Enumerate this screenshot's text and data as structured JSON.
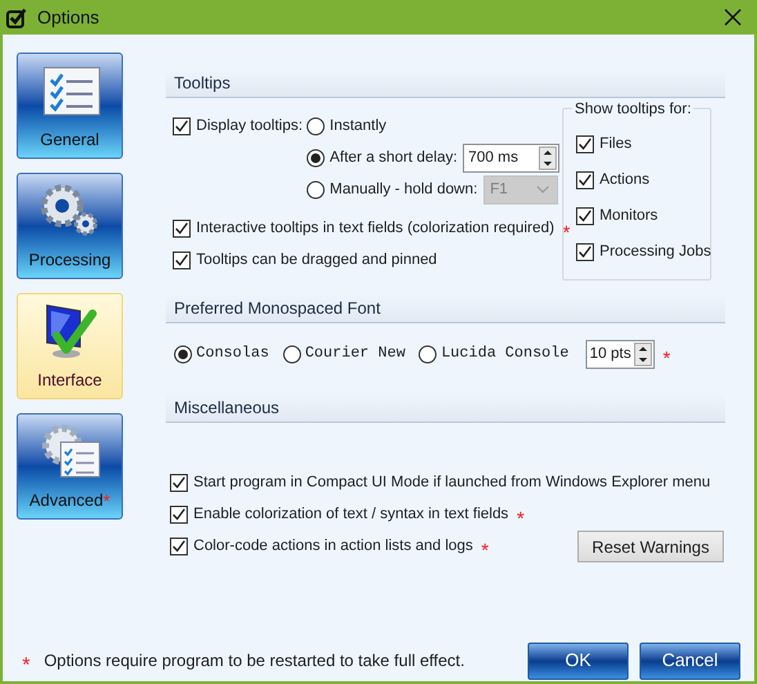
{
  "window": {
    "title": "Options"
  },
  "sidebar": [
    {
      "label": "General",
      "kind": "checklist",
      "selected": false
    },
    {
      "label": "Processing",
      "kind": "gears",
      "selected": false
    },
    {
      "label": "Interface",
      "kind": "monitor",
      "selected": true
    },
    {
      "label": "Advanced",
      "kind": "gearlist",
      "selected": false,
      "mark": "*"
    }
  ],
  "tooltips": {
    "title": "Tooltips",
    "display": {
      "label": "Display tooltips:",
      "checked": true
    },
    "timing": [
      {
        "kind": "plain",
        "label": "Instantly",
        "selected": false
      },
      {
        "kind": "spinner",
        "label": "After a short delay:",
        "selected": true,
        "value": "700 ms"
      },
      {
        "kind": "dropdown",
        "label": "Manually - hold down:",
        "selected": false,
        "value": "F1",
        "disabled": true
      }
    ],
    "options": [
      {
        "label": "Interactive tooltips in text fields (colorization required)",
        "checked": true,
        "mark": "*"
      },
      {
        "label": "Tooltips can be dragged and pinned",
        "checked": true
      }
    ],
    "show_for": {
      "title": "Show tooltips for:",
      "items": [
        {
          "label": "Files",
          "checked": true
        },
        {
          "label": "Actions",
          "checked": true
        },
        {
          "label": "Monitors",
          "checked": true
        },
        {
          "label": "Processing Jobs",
          "checked": true
        }
      ]
    }
  },
  "font": {
    "title": "Preferred Monospaced Font",
    "choices": [
      {
        "label": "Consolas",
        "selected": true
      },
      {
        "label": "Courier New",
        "selected": false
      },
      {
        "label": "Lucida Console",
        "selected": false
      }
    ],
    "size": "10 pts",
    "mark": "*"
  },
  "misc": {
    "title": "Miscellaneous",
    "options": [
      {
        "label": "Start program in Compact UI Mode if launched from Windows Explorer menu",
        "checked": true
      },
      {
        "label": "Enable colorization of text / syntax in text fields",
        "checked": true,
        "mark": "*"
      },
      {
        "label": "Color-code actions in action lists and logs",
        "checked": true,
        "mark": "*"
      }
    ],
    "reset_button": "Reset Warnings"
  },
  "footer": {
    "mark": "*",
    "note": "Options require program to be restarted to take full effect.",
    "buttons": [
      "OK",
      "Cancel"
    ]
  }
}
